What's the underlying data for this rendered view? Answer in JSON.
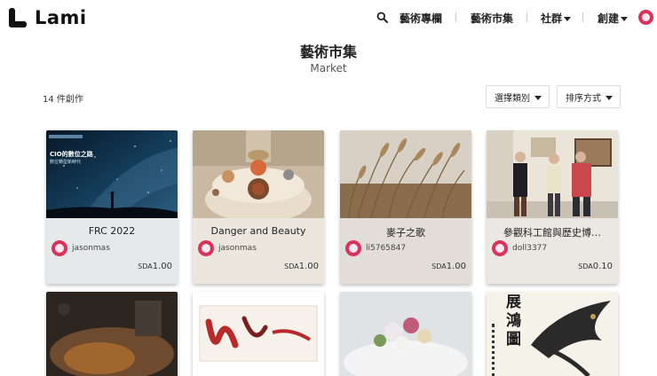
{
  "header": {
    "logo_text": "Lami",
    "nav": {
      "articles": "藝術專欄",
      "market": "藝術市集",
      "community": "社群",
      "create": "創建"
    }
  },
  "page": {
    "title": "藝術市集",
    "subtitle": "Market",
    "count": "14 件創作",
    "category_select": "選擇類別",
    "sort_select": "排序方式"
  },
  "cards": [
    {
      "title": "FRC 2022",
      "user": "jasonmas",
      "currency": "SDA",
      "amount": "1.00",
      "bg": "#e6e9ea",
      "thumb_text": "CIO的數位之路",
      "thumb_sub": "數位轉型新時代"
    },
    {
      "title": "Danger and Beauty",
      "user": "jasonmas",
      "currency": "SDA",
      "amount": "1.00",
      "bg": "#ece7de"
    },
    {
      "title": "麥子之歌",
      "user": "li5765847",
      "currency": "SDA",
      "amount": "1.00",
      "bg": "#e3ddd8"
    },
    {
      "title": "參觀科工館與歷史博…",
      "user": "doll3377",
      "currency": "SDA",
      "amount": "0.10",
      "bg": "#ebe7e2"
    }
  ],
  "row2": {
    "calligraphy_text": "展鴻圖"
  }
}
